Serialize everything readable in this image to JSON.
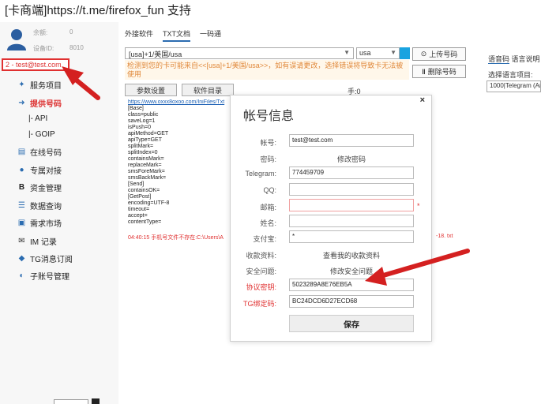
{
  "window_title": "[卡商端]https://t.me/firefox_fun 支持",
  "sidebar": {
    "balance_label": "余额:",
    "balance_value": "0",
    "device_label": "设备ID:",
    "device_value": "8010",
    "account": "2 - test@test.com",
    "items": [
      {
        "label": "服务项目",
        "icon": "tools-icon"
      },
      {
        "label": "提供号码",
        "icon": "arrow-icon",
        "active": true
      },
      {
        "label": "|- API",
        "sub": true
      },
      {
        "label": "|- GOIP",
        "sub": true
      },
      {
        "label": "在线号码",
        "icon": "list-icon"
      },
      {
        "label": "专属对接",
        "icon": "link-icon"
      },
      {
        "label": "资金管理",
        "icon": "bold-icon"
      },
      {
        "label": "数据查询",
        "icon": "search-list-icon"
      },
      {
        "label": "需求市场",
        "icon": "market-icon"
      },
      {
        "label": "IM 记录",
        "icon": "mail-icon"
      },
      {
        "label": "TG消息订阅",
        "icon": "telegram-icon"
      },
      {
        "label": "子账号管理",
        "icon": "users-icon"
      }
    ]
  },
  "tabs": [
    "外接软件",
    "TXT文档",
    "一码通"
  ],
  "active_tab": "TXT文档",
  "service_select": "[usa]+1/美国/usa",
  "search_value": "usa",
  "warning": "检测到您的卡可能来自<<[usa]+1/美国/usa>>，如有误请更改，选择错误将导致卡无法被使用",
  "upload_label": "上传号码",
  "delete_label": "删除号码",
  "lang": {
    "tab1": "语音码",
    "tab2": "语言说明",
    "label": "选择语言项目:",
    "select": "1000|Telegram (Am"
  },
  "param_button": "参数设置",
  "dir_button": "软件目录",
  "count_label": "手:0",
  "config": {
    "link": "https://www.oxxx8oxoo.com/IniFiles/Txt",
    "lines": "[Base]\nclass=public\nsaveLog=1\nisPush=0\napiMethod=GET\napiType=GET\nsplitMark=\nsplitIndex=0\ncontainsMark=\nreplaceMark=\nsmsForeMark=\nsmsBackMark=\n[Send]\ncontainsOK=\n[GetPost]\nencoding=UTF-8\ntimeout=\naccept=\ncontentType=",
    "log": "04:40:15 手机号文件不存在:C:\\Users\\A",
    "log_tail": "-18. txt"
  },
  "modal": {
    "title": "帐号信息",
    "close": "×",
    "account_label": "帐号:",
    "account_value": "test@test.com",
    "password_label": "密码:",
    "password_link": "修改密码",
    "telegram_label": "Telegram:",
    "telegram_value": "774459709",
    "qq_label": "QQ:",
    "qq_value": "",
    "email_label": "邮箱:",
    "email_value": "",
    "email_required": "*",
    "name_label": "姓名:",
    "name_value": "",
    "alipay_label": "支付宝:",
    "alipay_value": "*",
    "payment_label": "收款资料:",
    "payment_link": "查看我的收款资料",
    "security_label": "安全问题:",
    "security_link": "修改安全问题",
    "protocol_label": "协议密钥:",
    "protocol_value": "5023289A8E76EB5A",
    "tg_label": "TG绑定码:",
    "tg_value": "BC24DCD6D27ECD68",
    "save_label": "保存"
  },
  "colors": {
    "accent": "#2b6cb0",
    "danger": "#e03030",
    "warning": "#e0883a",
    "arrow": "#d42020"
  }
}
